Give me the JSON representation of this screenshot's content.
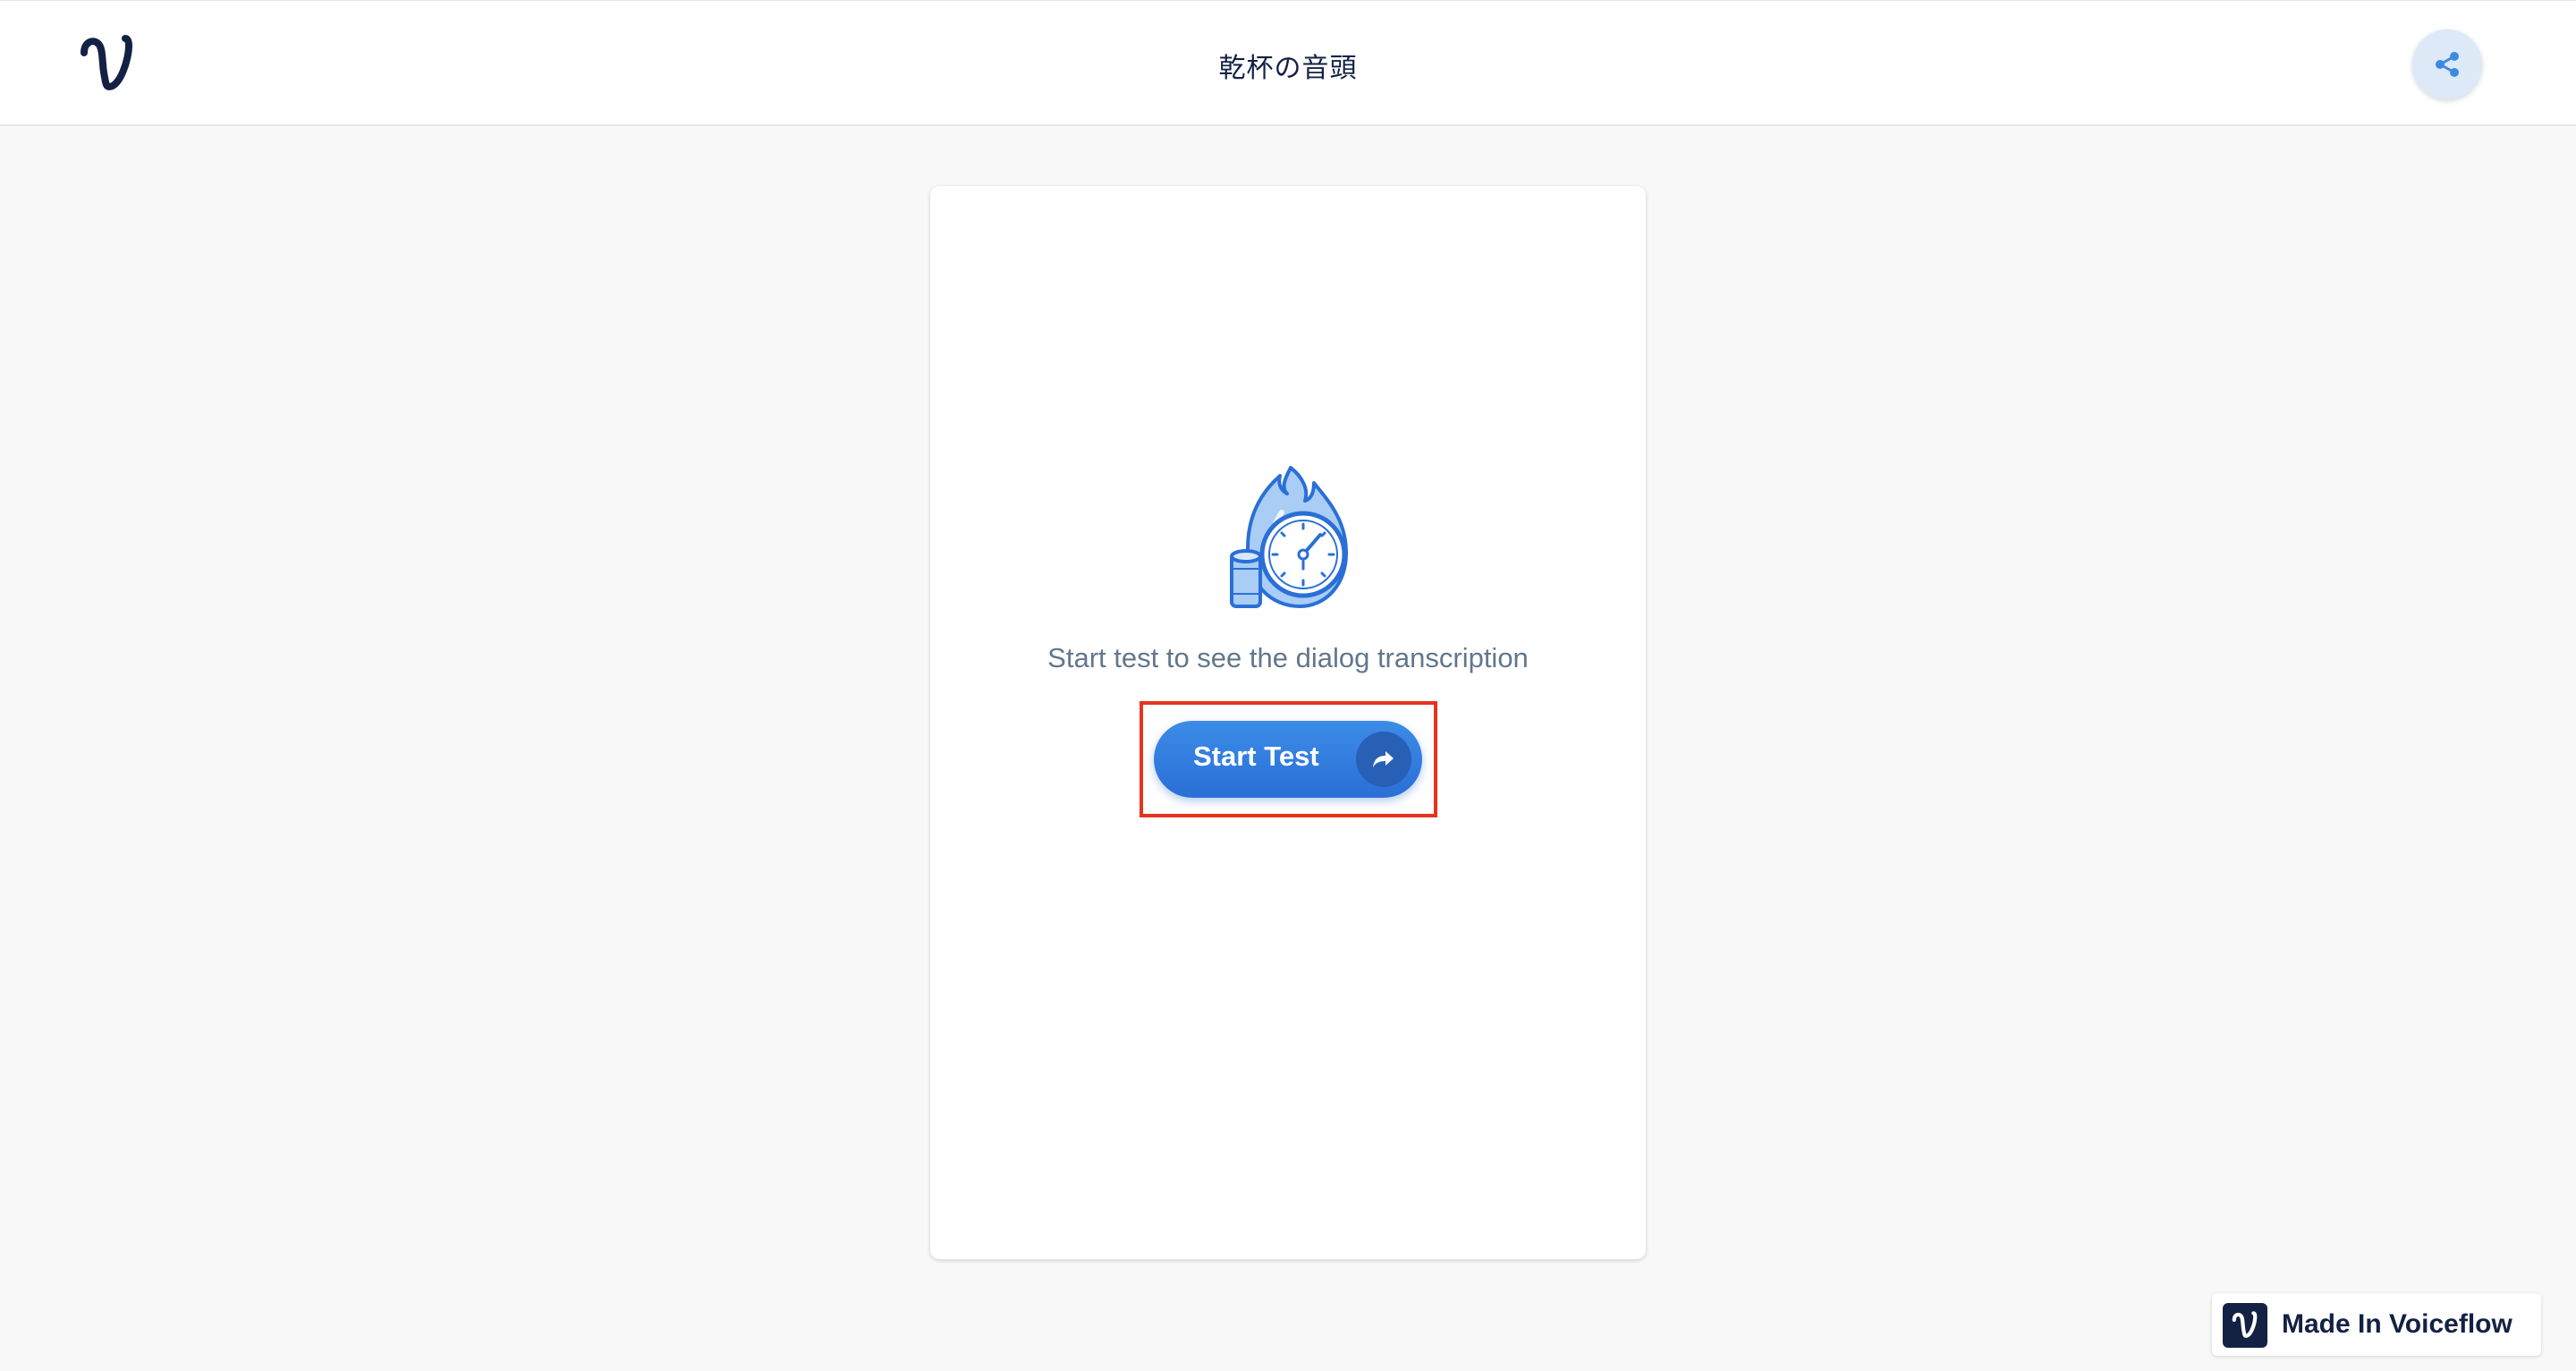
{
  "header": {
    "title": "乾杯の音頭",
    "logo_icon": "voiceflow-logo-icon",
    "share_icon": "share-icon"
  },
  "card": {
    "illustration_icon": "flame-stopwatch-speaker-icon",
    "hint_text": "Start test to see the dialog transcription",
    "start_button": {
      "label": "Start Test",
      "icon": "share-arrow-icon"
    }
  },
  "footer_badge": {
    "label": "Made In Voiceflow",
    "icon": "voiceflow-logo-icon"
  },
  "colors": {
    "accent": "#2a6fd6",
    "brand_dark": "#132144",
    "highlight": "#e8321e",
    "background": "#f8f8f8"
  }
}
